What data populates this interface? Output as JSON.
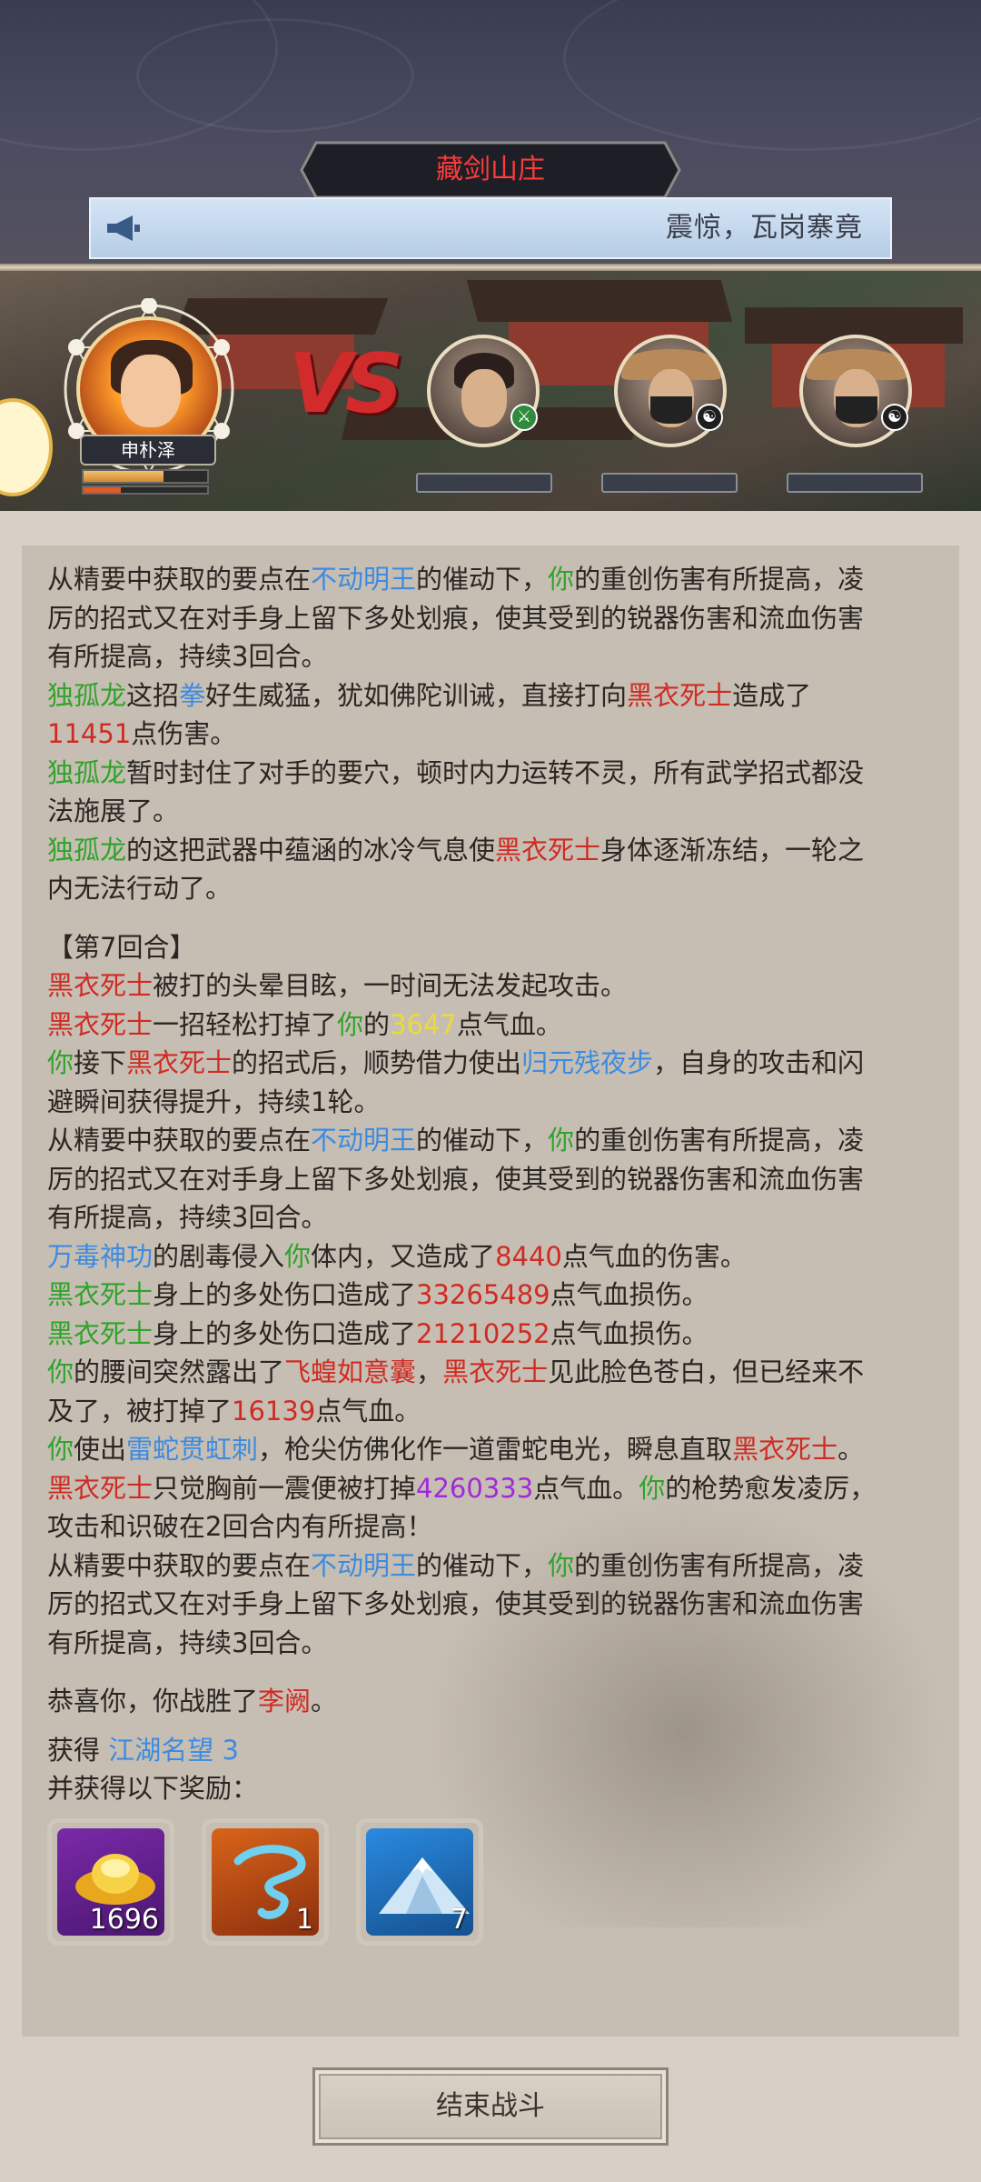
{
  "header": {
    "location": "藏剑山庄",
    "notice": "震惊，瓦岗寨竟"
  },
  "battle": {
    "player_name": "申朴泽",
    "player_hp_fraction": 0.65,
    "vs_label": "VS"
  },
  "log": {
    "lines": [
      [
        {
          "t": "从精要中获取的要点在"
        },
        {
          "t": "不动明王",
          "c": "b"
        },
        {
          "t": "的催动下，"
        },
        {
          "t": "你",
          "c": "g"
        },
        {
          "t": "的重创伤害有所提高，凌"
        }
      ],
      [
        {
          "t": "厉的招式又在对手身上留下多处划痕，使其受到的锐器伤害和流血伤害"
        }
      ],
      [
        {
          "t": "有所提高，持续3回合。"
        }
      ],
      [
        {
          "t": "独孤龙",
          "c": "g"
        },
        {
          "t": "这招"
        },
        {
          "t": "拳",
          "c": "b"
        },
        {
          "t": "好生威猛，犹如佛陀训诫，直接打向"
        },
        {
          "t": "黑衣死士",
          "c": "r"
        },
        {
          "t": "造成了"
        }
      ],
      [
        {
          "t": "11451",
          "c": "r"
        },
        {
          "t": "点伤害。"
        }
      ],
      [
        {
          "t": "独孤龙",
          "c": "g"
        },
        {
          "t": "暂时封住了对手的要穴，顿时内力运转不灵，所有武学招式都没"
        }
      ],
      [
        {
          "t": "法施展了。"
        }
      ],
      [
        {
          "t": "独孤龙",
          "c": "g"
        },
        {
          "t": "的这把武器中蕴涵的冰冷气息使"
        },
        {
          "t": "黑衣死士",
          "c": "r"
        },
        {
          "t": "身体逐渐冻结，一轮之"
        }
      ],
      [
        {
          "t": "内无法行动了。"
        }
      ],
      "GAP",
      [
        {
          "t": "【第7回合】"
        }
      ],
      [
        {
          "t": "黑衣死士",
          "c": "r"
        },
        {
          "t": "被打的头晕目眩，一时间无法发起攻击。"
        }
      ],
      [
        {
          "t": "黑衣死士",
          "c": "r"
        },
        {
          "t": "一招轻松打掉了"
        },
        {
          "t": "你",
          "c": "g"
        },
        {
          "t": "的"
        },
        {
          "t": "3647",
          "c": "y"
        },
        {
          "t": "点气血。"
        }
      ],
      [
        {
          "t": "你",
          "c": "g"
        },
        {
          "t": "接下"
        },
        {
          "t": "黑衣死士",
          "c": "r"
        },
        {
          "t": "的招式后，顺势借力使出"
        },
        {
          "t": "归元残夜步",
          "c": "b"
        },
        {
          "t": "，自身的攻击和闪"
        }
      ],
      [
        {
          "t": "避瞬间获得提升，持续1轮。"
        }
      ],
      [
        {
          "t": "从精要中获取的要点在"
        },
        {
          "t": "不动明王",
          "c": "b"
        },
        {
          "t": "的催动下，"
        },
        {
          "t": "你",
          "c": "g"
        },
        {
          "t": "的重创伤害有所提高，凌"
        }
      ],
      [
        {
          "t": "厉的招式又在对手身上留下多处划痕，使其受到的锐器伤害和流血伤害"
        }
      ],
      [
        {
          "t": "有所提高，持续3回合。"
        }
      ],
      [
        {
          "t": "万毒神功",
          "c": "b"
        },
        {
          "t": "的剧毒侵入"
        },
        {
          "t": "你",
          "c": "g"
        },
        {
          "t": "体内，又造成了"
        },
        {
          "t": "8440",
          "c": "r"
        },
        {
          "t": "点气血的伤害。"
        }
      ],
      [
        {
          "t": "黑衣死士",
          "c": "g"
        },
        {
          "t": "身上的多处伤口造成了"
        },
        {
          "t": "33265489",
          "c": "r"
        },
        {
          "t": "点气血损伤。"
        }
      ],
      [
        {
          "t": "黑衣死士",
          "c": "g"
        },
        {
          "t": "身上的多处伤口造成了"
        },
        {
          "t": "21210252",
          "c": "r"
        },
        {
          "t": "点气血损伤。"
        }
      ],
      [
        {
          "t": "你",
          "c": "g"
        },
        {
          "t": "的腰间突然露出了"
        },
        {
          "t": "飞蝗如意囊",
          "c": "r"
        },
        {
          "t": "，"
        },
        {
          "t": "黑衣死士",
          "c": "r"
        },
        {
          "t": "见此脸色苍白，但已经来不"
        }
      ],
      [
        {
          "t": "及了，被打掉了"
        },
        {
          "t": "16139",
          "c": "r"
        },
        {
          "t": "点气血。"
        }
      ],
      [
        {
          "t": "你",
          "c": "g"
        },
        {
          "t": "使出"
        },
        {
          "t": "雷蛇贯虹刺",
          "c": "b"
        },
        {
          "t": "，枪尖仿佛化作一道雷蛇电光，瞬息直取"
        },
        {
          "t": "黑衣死士",
          "c": "r"
        },
        {
          "t": "。"
        }
      ],
      [
        {
          "t": "黑衣死士",
          "c": "r"
        },
        {
          "t": "只觉胸前一震便被打掉"
        },
        {
          "t": "4260333",
          "c": "p"
        },
        {
          "t": "点气血。"
        },
        {
          "t": "你",
          "c": "g"
        },
        {
          "t": "的枪势愈发凌厉，"
        }
      ],
      [
        {
          "t": "攻击和识破在2回合内有所提高！"
        }
      ],
      [
        {
          "t": "从精要中获取的要点在"
        },
        {
          "t": "不动明王",
          "c": "b"
        },
        {
          "t": "的催动下，"
        },
        {
          "t": "你",
          "c": "g"
        },
        {
          "t": "的重创伤害有所提高，凌"
        }
      ],
      [
        {
          "t": "厉的招式又在对手身上留下多处划痕，使其受到的锐器伤害和流血伤害"
        }
      ],
      [
        {
          "t": "有所提高，持续3回合。"
        }
      ],
      "GAP",
      [
        {
          "t": "恭喜你，你战胜了"
        },
        {
          "t": "李阙",
          "c": "r"
        },
        {
          "t": "。"
        }
      ]
    ]
  },
  "rewards": {
    "gain_prefix": "获得",
    "reputation_label": "江湖名望 3",
    "extra_label": "并获得以下奖励：",
    "items": [
      {
        "icon": "gold-ingot-icon",
        "qty": "1696",
        "frame": "#9b2fc4"
      },
      {
        "icon": "cyclone-icon",
        "qty": "1",
        "frame": "#e07a18"
      },
      {
        "icon": "snow-mountain-icon",
        "qty": "7",
        "frame": "#2f7fd4"
      }
    ]
  },
  "footer": {
    "end_button": "结束战斗"
  },
  "colors": {
    "blue": "#3c8be0",
    "green": "#2fa32a",
    "red": "#cf2b23",
    "yellow": "#e9dc3a",
    "purple": "#a02ad8"
  }
}
